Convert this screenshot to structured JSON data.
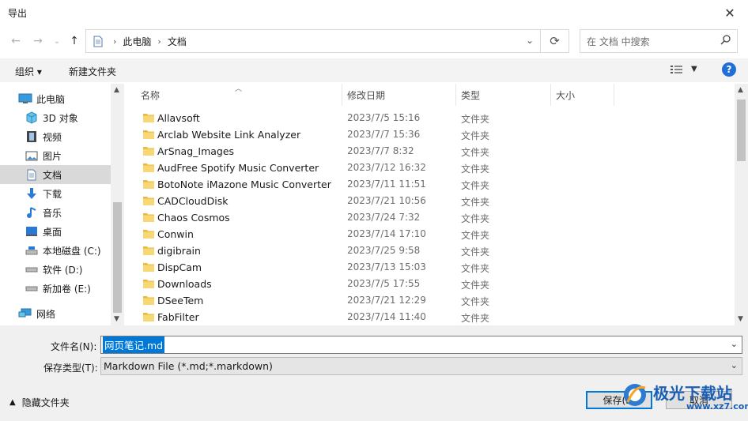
{
  "window": {
    "title": "导出",
    "close_glyph": "✕"
  },
  "nav": {
    "back_icon": "←",
    "forward_icon": "→",
    "recent_icon": "⌄",
    "up_icon": "↑",
    "breadcrumb": [
      "此电脑",
      "文档"
    ],
    "refresh_icon": "⟳",
    "search_placeholder": "在 文档 中搜索"
  },
  "toolbar": {
    "organize_label": "组织 ▾",
    "new_folder_label": "新建文件夹",
    "help_label": "?"
  },
  "sidebar": {
    "items": [
      {
        "label": "此电脑",
        "icon": "computer-icon"
      },
      {
        "label": "3D 对象",
        "icon": "cube-icon"
      },
      {
        "label": "视频",
        "icon": "film-icon"
      },
      {
        "label": "图片",
        "icon": "picture-icon"
      },
      {
        "label": "文档",
        "icon": "document-icon",
        "selected": true
      },
      {
        "label": "下载",
        "icon": "download-icon"
      },
      {
        "label": "音乐",
        "icon": "music-icon"
      },
      {
        "label": "桌面",
        "icon": "desktop-icon"
      },
      {
        "label": "本地磁盘 (C:)",
        "icon": "drive-icon"
      },
      {
        "label": "软件 (D:)",
        "icon": "drive-icon"
      },
      {
        "label": "新加卷 (E:)",
        "icon": "drive-icon"
      },
      {
        "label": "网络",
        "icon": "network-icon"
      }
    ]
  },
  "columns": {
    "name": "名称",
    "date": "修改日期",
    "type": "类型",
    "size": "大小"
  },
  "files": [
    {
      "name": "Allavsoft",
      "date": "2023/7/5 15:16",
      "type": "文件夹"
    },
    {
      "name": "Arclab Website Link Analyzer",
      "date": "2023/7/7 15:36",
      "type": "文件夹"
    },
    {
      "name": "ArSnag_Images",
      "date": "2023/7/7 8:32",
      "type": "文件夹"
    },
    {
      "name": "AudFree Spotify Music Converter",
      "date": "2023/7/12 16:32",
      "type": "文件夹"
    },
    {
      "name": "BotoNote iMazone Music Converter",
      "date": "2023/7/11 11:51",
      "type": "文件夹"
    },
    {
      "name": "CADCloudDisk",
      "date": "2023/7/21 10:56",
      "type": "文件夹"
    },
    {
      "name": "Chaos Cosmos",
      "date": "2023/7/24 7:32",
      "type": "文件夹"
    },
    {
      "name": "Conwin",
      "date": "2023/7/14 17:10",
      "type": "文件夹"
    },
    {
      "name": "digibrain",
      "date": "2023/7/25 9:58",
      "type": "文件夹"
    },
    {
      "name": "DispCam",
      "date": "2023/7/13 15:03",
      "type": "文件夹"
    },
    {
      "name": "Downloads",
      "date": "2023/7/5 17:55",
      "type": "文件夹"
    },
    {
      "name": "DSeeTem",
      "date": "2023/7/21 12:29",
      "type": "文件夹"
    },
    {
      "name": "FabFilter",
      "date": "2023/7/14 11:40",
      "type": "文件夹"
    }
  ],
  "form": {
    "filename_label": "文件名(N):",
    "filename_value": "网页笔记.md",
    "filetype_label": "保存类型(T):",
    "filetype_value": "Markdown File (*.md;*.markdown)",
    "hide_folders_label": "隐藏文件夹",
    "save_label": "保存(S)",
    "cancel_label": "取消"
  },
  "watermark": {
    "text": "极光下载站",
    "url": "www.xz7.com"
  },
  "colors": {
    "accent": "#0078d7",
    "folder": "#f8d775",
    "selection": "#d9d9d9",
    "help": "#1f6fd6"
  }
}
